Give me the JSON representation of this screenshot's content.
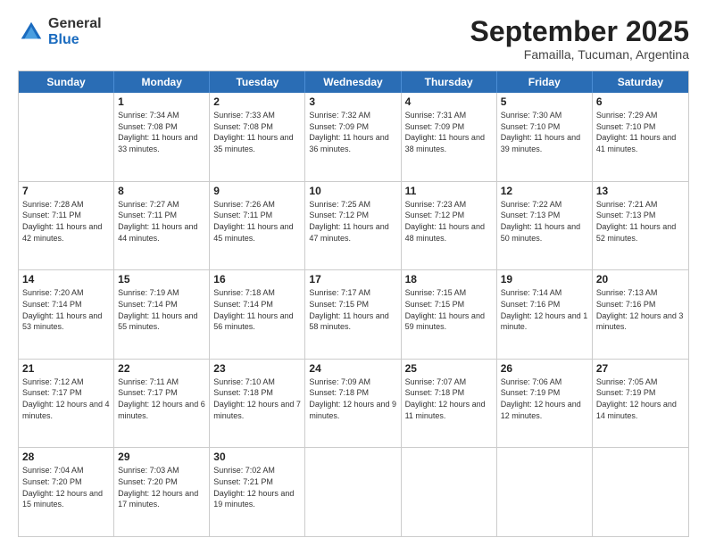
{
  "logo": {
    "general": "General",
    "blue": "Blue"
  },
  "title": "September 2025",
  "subtitle": "Famailla, Tucuman, Argentina",
  "days": [
    "Sunday",
    "Monday",
    "Tuesday",
    "Wednesday",
    "Thursday",
    "Friday",
    "Saturday"
  ],
  "rows": [
    [
      {
        "day": "",
        "sunrise": "",
        "sunset": "",
        "daylight": ""
      },
      {
        "day": "1",
        "sunrise": "Sunrise: 7:34 AM",
        "sunset": "Sunset: 7:08 PM",
        "daylight": "Daylight: 11 hours and 33 minutes."
      },
      {
        "day": "2",
        "sunrise": "Sunrise: 7:33 AM",
        "sunset": "Sunset: 7:08 PM",
        "daylight": "Daylight: 11 hours and 35 minutes."
      },
      {
        "day": "3",
        "sunrise": "Sunrise: 7:32 AM",
        "sunset": "Sunset: 7:09 PM",
        "daylight": "Daylight: 11 hours and 36 minutes."
      },
      {
        "day": "4",
        "sunrise": "Sunrise: 7:31 AM",
        "sunset": "Sunset: 7:09 PM",
        "daylight": "Daylight: 11 hours and 38 minutes."
      },
      {
        "day": "5",
        "sunrise": "Sunrise: 7:30 AM",
        "sunset": "Sunset: 7:10 PM",
        "daylight": "Daylight: 11 hours and 39 minutes."
      },
      {
        "day": "6",
        "sunrise": "Sunrise: 7:29 AM",
        "sunset": "Sunset: 7:10 PM",
        "daylight": "Daylight: 11 hours and 41 minutes."
      }
    ],
    [
      {
        "day": "7",
        "sunrise": "Sunrise: 7:28 AM",
        "sunset": "Sunset: 7:11 PM",
        "daylight": "Daylight: 11 hours and 42 minutes."
      },
      {
        "day": "8",
        "sunrise": "Sunrise: 7:27 AM",
        "sunset": "Sunset: 7:11 PM",
        "daylight": "Daylight: 11 hours and 44 minutes."
      },
      {
        "day": "9",
        "sunrise": "Sunrise: 7:26 AM",
        "sunset": "Sunset: 7:11 PM",
        "daylight": "Daylight: 11 hours and 45 minutes."
      },
      {
        "day": "10",
        "sunrise": "Sunrise: 7:25 AM",
        "sunset": "Sunset: 7:12 PM",
        "daylight": "Daylight: 11 hours and 47 minutes."
      },
      {
        "day": "11",
        "sunrise": "Sunrise: 7:23 AM",
        "sunset": "Sunset: 7:12 PM",
        "daylight": "Daylight: 11 hours and 48 minutes."
      },
      {
        "day": "12",
        "sunrise": "Sunrise: 7:22 AM",
        "sunset": "Sunset: 7:13 PM",
        "daylight": "Daylight: 11 hours and 50 minutes."
      },
      {
        "day": "13",
        "sunrise": "Sunrise: 7:21 AM",
        "sunset": "Sunset: 7:13 PM",
        "daylight": "Daylight: 11 hours and 52 minutes."
      }
    ],
    [
      {
        "day": "14",
        "sunrise": "Sunrise: 7:20 AM",
        "sunset": "Sunset: 7:14 PM",
        "daylight": "Daylight: 11 hours and 53 minutes."
      },
      {
        "day": "15",
        "sunrise": "Sunrise: 7:19 AM",
        "sunset": "Sunset: 7:14 PM",
        "daylight": "Daylight: 11 hours and 55 minutes."
      },
      {
        "day": "16",
        "sunrise": "Sunrise: 7:18 AM",
        "sunset": "Sunset: 7:14 PM",
        "daylight": "Daylight: 11 hours and 56 minutes."
      },
      {
        "day": "17",
        "sunrise": "Sunrise: 7:17 AM",
        "sunset": "Sunset: 7:15 PM",
        "daylight": "Daylight: 11 hours and 58 minutes."
      },
      {
        "day": "18",
        "sunrise": "Sunrise: 7:15 AM",
        "sunset": "Sunset: 7:15 PM",
        "daylight": "Daylight: 11 hours and 59 minutes."
      },
      {
        "day": "19",
        "sunrise": "Sunrise: 7:14 AM",
        "sunset": "Sunset: 7:16 PM",
        "daylight": "Daylight: 12 hours and 1 minute."
      },
      {
        "day": "20",
        "sunrise": "Sunrise: 7:13 AM",
        "sunset": "Sunset: 7:16 PM",
        "daylight": "Daylight: 12 hours and 3 minutes."
      }
    ],
    [
      {
        "day": "21",
        "sunrise": "Sunrise: 7:12 AM",
        "sunset": "Sunset: 7:17 PM",
        "daylight": "Daylight: 12 hours and 4 minutes."
      },
      {
        "day": "22",
        "sunrise": "Sunrise: 7:11 AM",
        "sunset": "Sunset: 7:17 PM",
        "daylight": "Daylight: 12 hours and 6 minutes."
      },
      {
        "day": "23",
        "sunrise": "Sunrise: 7:10 AM",
        "sunset": "Sunset: 7:18 PM",
        "daylight": "Daylight: 12 hours and 7 minutes."
      },
      {
        "day": "24",
        "sunrise": "Sunrise: 7:09 AM",
        "sunset": "Sunset: 7:18 PM",
        "daylight": "Daylight: 12 hours and 9 minutes."
      },
      {
        "day": "25",
        "sunrise": "Sunrise: 7:07 AM",
        "sunset": "Sunset: 7:18 PM",
        "daylight": "Daylight: 12 hours and 11 minutes."
      },
      {
        "day": "26",
        "sunrise": "Sunrise: 7:06 AM",
        "sunset": "Sunset: 7:19 PM",
        "daylight": "Daylight: 12 hours and 12 minutes."
      },
      {
        "day": "27",
        "sunrise": "Sunrise: 7:05 AM",
        "sunset": "Sunset: 7:19 PM",
        "daylight": "Daylight: 12 hours and 14 minutes."
      }
    ],
    [
      {
        "day": "28",
        "sunrise": "Sunrise: 7:04 AM",
        "sunset": "Sunset: 7:20 PM",
        "daylight": "Daylight: 12 hours and 15 minutes."
      },
      {
        "day": "29",
        "sunrise": "Sunrise: 7:03 AM",
        "sunset": "Sunset: 7:20 PM",
        "daylight": "Daylight: 12 hours and 17 minutes."
      },
      {
        "day": "30",
        "sunrise": "Sunrise: 7:02 AM",
        "sunset": "Sunset: 7:21 PM",
        "daylight": "Daylight: 12 hours and 19 minutes."
      },
      {
        "day": "",
        "sunrise": "",
        "sunset": "",
        "daylight": ""
      },
      {
        "day": "",
        "sunrise": "",
        "sunset": "",
        "daylight": ""
      },
      {
        "day": "",
        "sunrise": "",
        "sunset": "",
        "daylight": ""
      },
      {
        "day": "",
        "sunrise": "",
        "sunset": "",
        "daylight": ""
      }
    ]
  ]
}
